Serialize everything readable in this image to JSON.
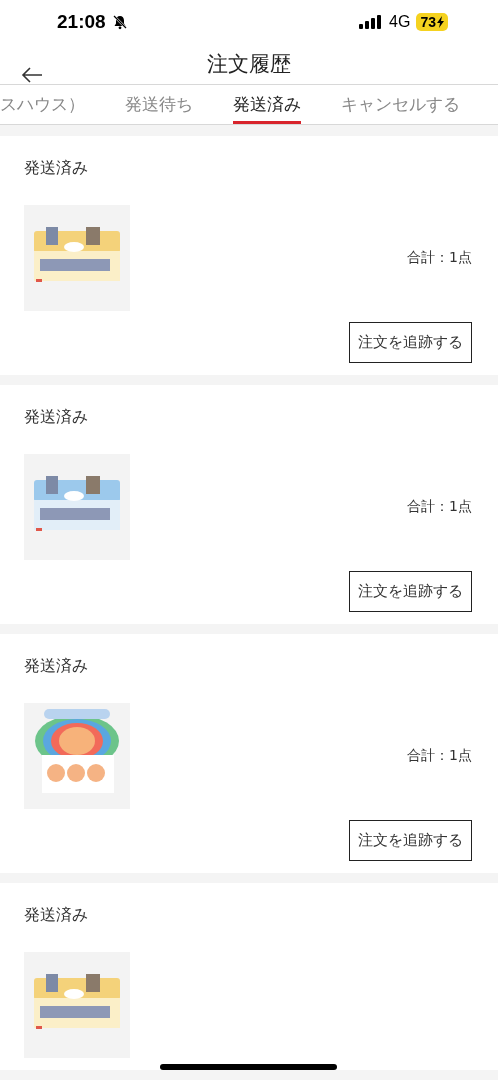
{
  "status_bar": {
    "time": "21:08",
    "network": "4G",
    "battery": "73"
  },
  "header": {
    "title": "注文履歴"
  },
  "tabs": [
    {
      "label": "スハウス）",
      "selected": false
    },
    {
      "label": "発送待ち",
      "selected": false
    },
    {
      "label": "発送済み",
      "selected": true
    },
    {
      "label": "キャンセルする",
      "selected": false
    }
  ],
  "orders": [
    {
      "status": "発送済み",
      "total": "合計：1点",
      "action": "注文を追跡する"
    },
    {
      "status": "発送済み",
      "total": "合計：1点",
      "action": "注文を追跡する"
    },
    {
      "status": "発送済み",
      "total": "合計：1点",
      "action": "注文を追跡する"
    },
    {
      "status": "発送済み"
    }
  ]
}
